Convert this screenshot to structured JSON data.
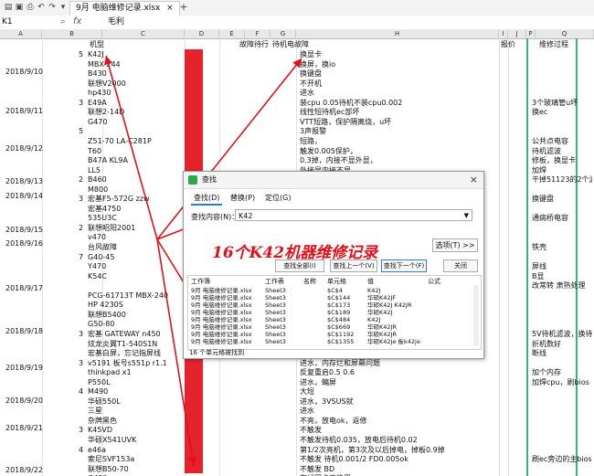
{
  "titlebar": {
    "cell_ref": "K1",
    "doc_name": "9月 电脑维修记录.xlsx",
    "plus": "+",
    "close_x": "×"
  },
  "formula": {
    "fx": "fx",
    "content": "毛利"
  },
  "columns": [
    "A",
    "B",
    "C",
    "D",
    "E",
    "F",
    "G",
    "H",
    "I",
    "J",
    "P",
    "Q"
  ],
  "headers": {
    "model": "机型",
    "fault_prefix": "故障待",
    "fault": "故障待行",
    "fault_machine": "待机电故障",
    "price": "报价",
    "process": "维修过程"
  },
  "dates": [
    "2018/9/10",
    "2018/9/11",
    "2018/9/12",
    "2018/9/13",
    "2018/9/14",
    "2018/9/15",
    "2018/9/16",
    "2018/9/17",
    "2018/9/18",
    "2018/9/19",
    "2018/9/20",
    "2018/9/21",
    "2018/9/22"
  ],
  "numbers": [
    "5",
    "3",
    "5",
    "2",
    "3",
    "2",
    "7",
    "3",
    "3",
    "4",
    "3",
    "4"
  ],
  "models": [
    "K42J",
    "MBX-244",
    "B430",
    "联想V2000",
    "hp430",
    "E49A",
    "联想2-14D",
    "G470",
    "",
    "Z51-70 LA-C281P",
    "T60",
    "B47A KL9A",
    "LL5",
    "B460",
    "M800",
    "宏基F5-572G zzw",
    "宏基4750",
    "535U3C",
    "联想昭阳2001",
    "v470",
    "台风故障",
    "G40-45",
    "Y470",
    "K54C",
    "",
    "PCG-61713T  MBX-240",
    "HP 4230S",
    "联想B5400",
    "G50-80",
    "宏基 GATEWAY n450",
    "炫龙炎翼T1-540S1N",
    "宏基白屏，忘记指屏线",
    "v5191  板号s551p r1.1",
    "thinkpad x1",
    "P550L",
    "M490",
    "华硕550L",
    "三星",
    "杂牌黑色",
    "K45VD",
    "华硕X541UVK",
    "e46a",
    "索尼SVF153a",
    "联想B50-70",
    "G430"
  ],
  "faults": [
    "换显卡",
    "换屏，换io",
    "换键盘",
    "不开机",
    "进水",
    "装cpu 0.05待机不装cpu0.002",
    "线性短待机ec部坏",
    "VTT短路，保护隔离烧，u坏",
    "3声报警",
    "短路，",
    "触发0.005保护，",
    "0.3掉，内接不显外显，",
    "外接显内接不显，",
    "",
    "",
    "",
    "",
    "",
    "",
    "",
    "",
    "",
    "",
    "",
    "",
    "",
    "",
    "",
    "",
    "",
    "",
    "",
    "进水，内存烂和屏幕问题",
    "反复重启0.5  0.6",
    "进水，蝙屏",
    "大短",
    "进水，3VSUS就",
    "进水",
    "不亮，放电ok，返修",
    "不触发",
    "不触发待机0.035，放电后待机0.02",
    "第1/2次亮机，第3次及以后掉电，掉板0.9掉",
    "不触发 待机0.001/2 FD0.005ok",
    "不触发 BD",
    "有线固卡不能用"
  ],
  "process": [
    "",
    "",
    "",
    "",
    "",
    "3个玻璃管u坏",
    "换ec",
    "",
    "",
    "公共点电容",
    "待机滤波",
    "修板，换显卡",
    "加焊",
    "干掉51123的2个滤",
    "",
    "换键盘",
    "",
    "通病桥电容",
    "",
    "",
    "铁壳",
    "",
    "屏线",
    "B显",
    "改常转 肃熟处理",
    "",
    "",
    "",
    "",
    "5V待机滤波，换待",
    "折机数好",
    "断线",
    "",
    "加个内存",
    "加焊cpu，刷bios",
    "",
    "",
    "",
    "",
    "",
    "",
    "",
    "刷ec旁边的主bios",
    "",
    ""
  ],
  "dialog": {
    "title": "查找",
    "tabs": [
      "查找(D)",
      "替换(P)",
      "定位(G)"
    ],
    "find_label": "查找内容(N)：",
    "find_value": "K42",
    "options": "选项(T) >>",
    "find_all": "查找全部(I)",
    "find_prev": "查找上一个(V)",
    "find_next": "查找下一个(F)",
    "close": "关闭",
    "result_headers": [
      "工作簿",
      "工作表",
      "名称",
      "单元格",
      "值",
      "公式"
    ],
    "results": [
      [
        "9月 电脑维修记录.xlsx",
        "Sheet3",
        "",
        "$C$4",
        "K42J"
      ],
      [
        "9月 电脑维修记录.xlsx",
        "Sheet3",
        "",
        "$C$144",
        "华硕K42JF"
      ],
      [
        "9月 电脑维修记录.xlsx",
        "Sheet3",
        "",
        "$C$173",
        "华硕K42J  K42JR"
      ],
      [
        "9月 电脑维修记录.xlsx",
        "Sheet3",
        "",
        "$C$189",
        "华硕K42J"
      ],
      [
        "9月 电脑维修记录.xlsx",
        "Sheet3",
        "",
        "$C$484",
        "K42J"
      ],
      [
        "9月 电脑维修记录.xlsx",
        "Sheet3",
        "",
        "$C$669",
        "华硕K42JR"
      ],
      [
        "9月 电脑维修记录.xlsx",
        "Sheet3",
        "",
        "$C$1192",
        "华硕K42JR"
      ],
      [
        "9月 电脑维修记录.xlsx",
        "Sheet3",
        "",
        "$C$1355",
        "华硕K42Je 板k42je"
      ]
    ],
    "status": "16 个单元格被找到"
  },
  "caption": "16个K42机器维修记录"
}
